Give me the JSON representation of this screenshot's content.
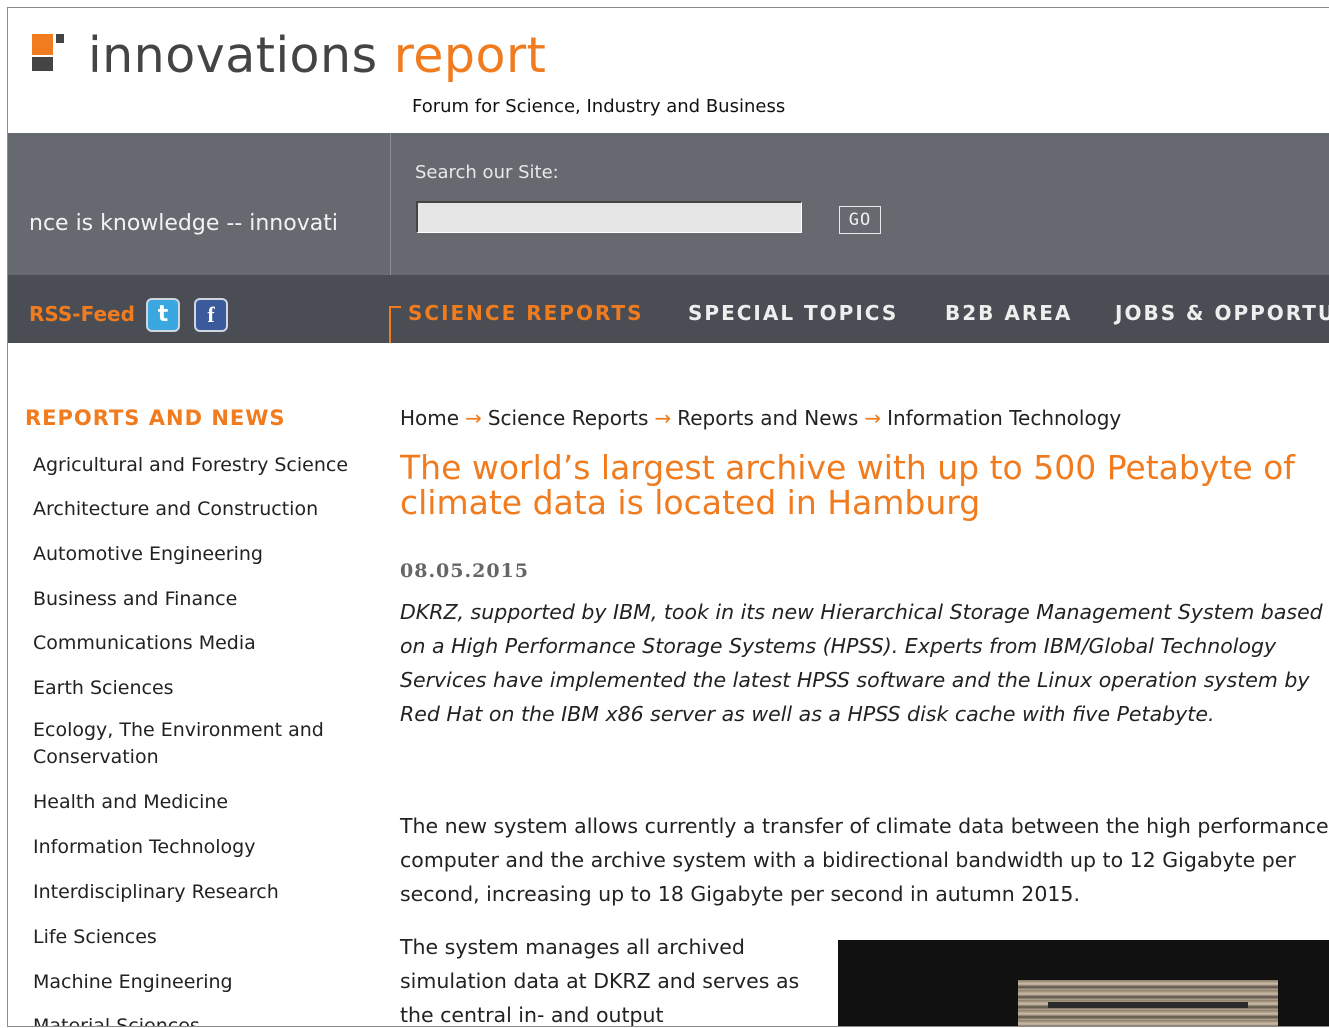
{
  "header": {
    "title_part1": "innovations",
    "title_part2": "report",
    "tagline": "Forum for Science, Industry and Business"
  },
  "band": {
    "marquee_text": "nce is knowledge -- innovati",
    "search_label": "Search our Site:",
    "search_value": "",
    "go_label": "GO"
  },
  "nav": {
    "rss_label": "RSS-Feed",
    "twitter_glyph": "t",
    "facebook_glyph": "f",
    "items": [
      "SCIENCE REPORTS",
      "SPECIAL TOPICS",
      "B2B AREA",
      "JOBS & OPPORTU"
    ]
  },
  "sidebar": {
    "heading": "REPORTS AND NEWS",
    "items": [
      "Agricultural and Forestry Science",
      "Architecture and Construction",
      "Automotive Engineering",
      "Business and Finance",
      "Communications Media",
      "Earth Sciences",
      "Ecology, The Environment and Conservation",
      "Health and Medicine",
      "Information Technology",
      "Interdisciplinary Research",
      "Life Sciences",
      "Machine Engineering",
      "Material Sciences"
    ]
  },
  "breadcrumb": [
    "Home",
    "Science Reports",
    "Reports and News",
    "Information Technology"
  ],
  "breadcrumb_arrow": "→",
  "article": {
    "title": "The world’s largest archive with up to 500 Petabyte of climate data is located in Hamburg",
    "date": "08.05.2015",
    "lead": "DKRZ, supported by IBM, took in its new Hierarchical Storage Management System based on a High Performance Storage Systems (HPSS). Experts from IBM/Global Technology Services have implemented the latest HPSS software and the Linux operation system by Red Hat on the IBM x86 server as well as a HPSS disk cache with five Petabyte.",
    "p1": "The new system allows currently a transfer of climate data between the high performance computer and the archive system with a bidirectional bandwidth up to 12 Gigabyte per second, increasing up to 18 Gigabyte per second in autumn 2015.",
    "p2": "The system manages all archived simulation data at DKRZ and serves as the central in- and output"
  },
  "colors": {
    "accent": "#f07c1f",
    "band": "#666a70",
    "navbar": "#4a4d53"
  }
}
